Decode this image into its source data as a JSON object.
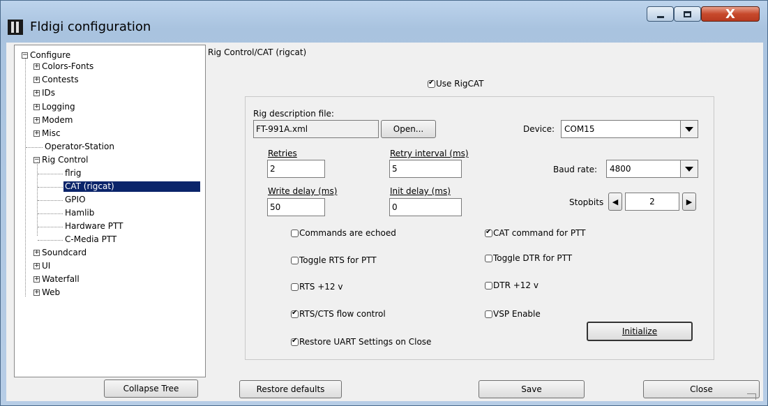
{
  "window": {
    "title": "Fldigi configuration",
    "close_glyph": "X"
  },
  "tree": {
    "root": "Configure",
    "items": [
      {
        "label": "Colors-Fonts",
        "expander": "+"
      },
      {
        "label": "Contests",
        "expander": "+"
      },
      {
        "label": "IDs",
        "expander": "+"
      },
      {
        "label": "Logging",
        "expander": "+"
      },
      {
        "label": "Modem",
        "expander": "+"
      },
      {
        "label": "Misc",
        "expander": "+"
      },
      {
        "label": "Operator-Station",
        "expander": ""
      },
      {
        "label": "Rig Control",
        "expander": "−"
      },
      {
        "label": "Soundcard",
        "expander": "+"
      },
      {
        "label": "UI",
        "expander": "+"
      },
      {
        "label": "Waterfall",
        "expander": "+"
      },
      {
        "label": "Web",
        "expander": "+"
      }
    ],
    "rig_children": [
      "flrig",
      "CAT (rigcat)",
      "GPIO",
      "Hamlib",
      "Hardware PTT",
      "C-Media PTT"
    ],
    "root_expander": "−"
  },
  "panel": {
    "title": "Rig Control/CAT (rigcat)",
    "use_rigcat": {
      "label": "Use RigCAT",
      "checked": true
    },
    "rig_file_label": "Rig description file:",
    "rig_file_value": "FT-991A.xml",
    "open_label": "Open...",
    "device_label": "Device:",
    "device_value": "COM15",
    "retries_label": "Retries",
    "retries_value": "2",
    "retry_interval_label": "Retry interval (ms)",
    "retry_interval_value": "5",
    "baud_label": "Baud rate:",
    "baud_value": "4800",
    "write_delay_label": "Write delay (ms)",
    "write_delay_value": "50",
    "init_delay_label": "Init delay (ms)",
    "init_delay_value": "0",
    "stopbits_label": "Stopbits",
    "stopbits_value": "2",
    "checks": {
      "commands_echoed": {
        "label": "Commands are echoed",
        "checked": false
      },
      "cat_ptt": {
        "label": "CAT command for PTT",
        "checked": true
      },
      "toggle_rts": {
        "label": "Toggle RTS for PTT",
        "checked": false
      },
      "toggle_dtr": {
        "label": "Toggle DTR for PTT",
        "checked": false
      },
      "rts12": {
        "label": "RTS +12 v",
        "checked": false
      },
      "dtr12": {
        "label": "DTR +12 v",
        "checked": false
      },
      "rtscts": {
        "label": "RTS/CTS flow control",
        "checked": true
      },
      "vsp": {
        "label": "VSP Enable",
        "checked": false
      },
      "restore_uart": {
        "label": "Restore UART Settings on Close",
        "checked": true
      }
    },
    "initialize_label": "Initialize"
  },
  "footer": {
    "collapse_tree": "Collapse Tree",
    "restore_defaults": "Restore defaults",
    "save": "Save",
    "close": "Close"
  }
}
